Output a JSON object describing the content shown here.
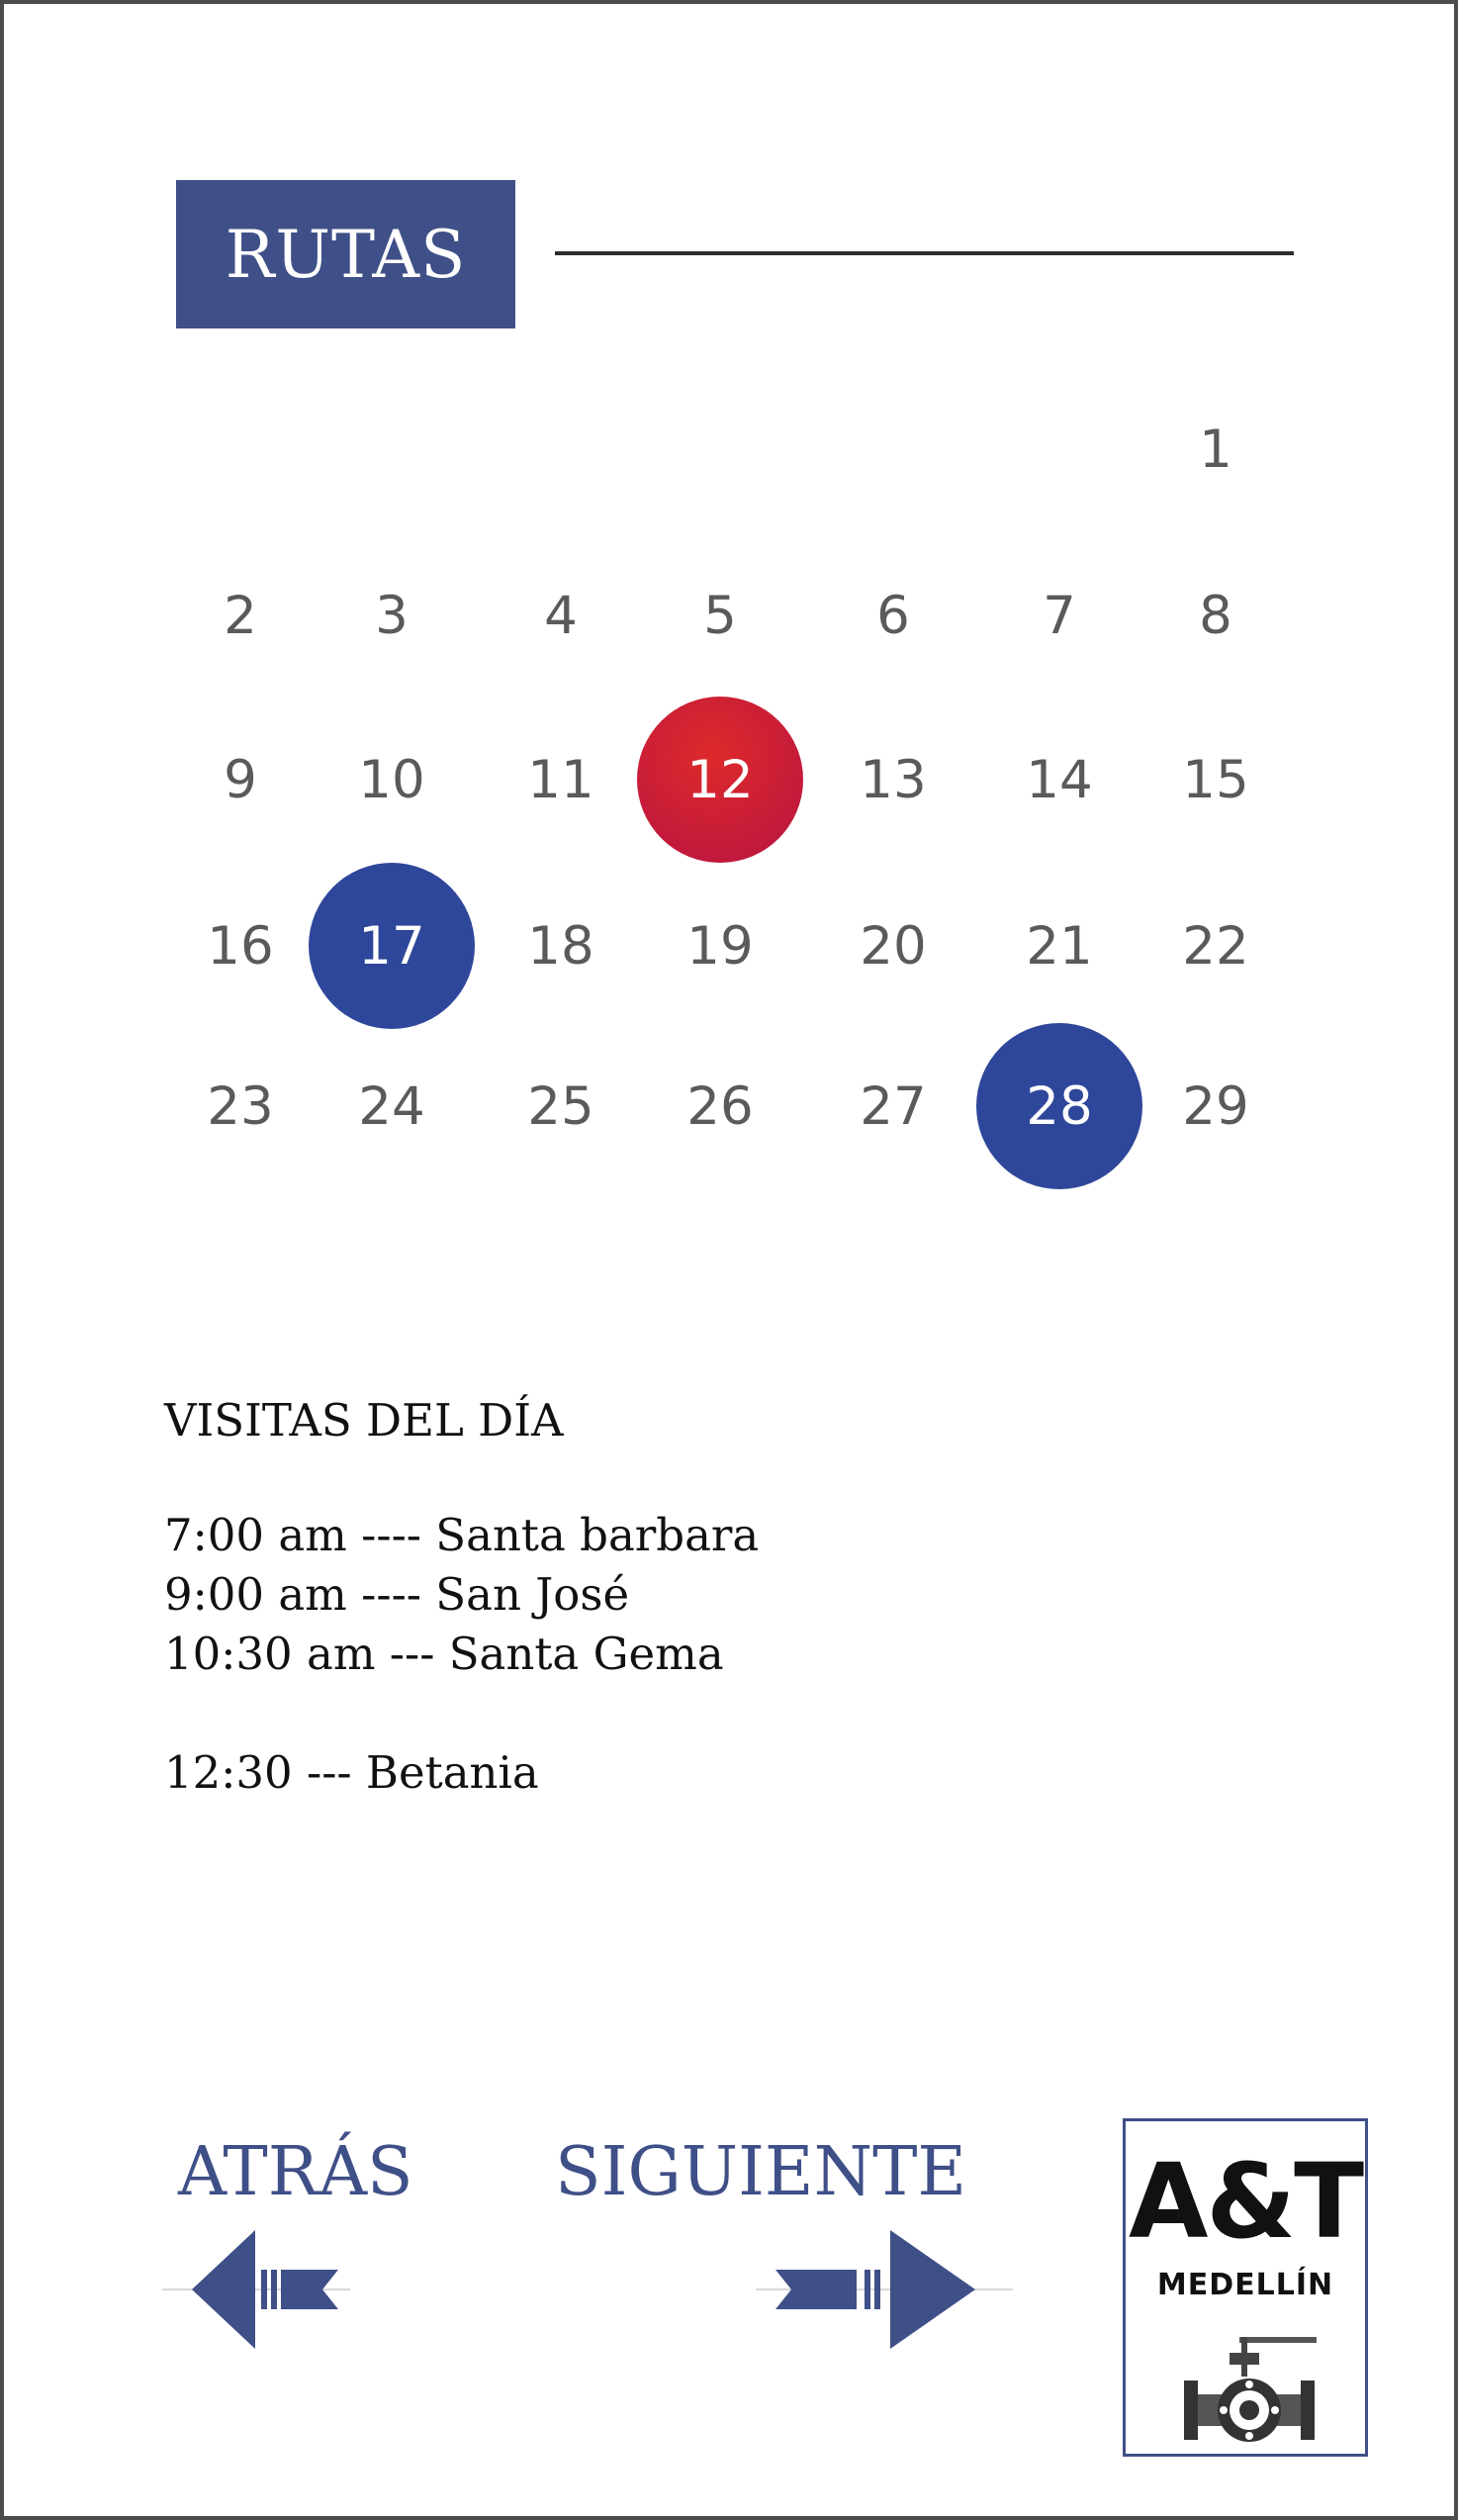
{
  "header": {
    "title": "RUTAS"
  },
  "calendar": {
    "days": [
      {
        "label": "1",
        "col": 7,
        "row": 1,
        "highlight": ""
      },
      {
        "label": "2",
        "col": 1,
        "row": 2,
        "highlight": ""
      },
      {
        "label": "3",
        "col": 2,
        "row": 2,
        "highlight": ""
      },
      {
        "label": "4",
        "col": 3,
        "row": 2,
        "highlight": ""
      },
      {
        "label": "5",
        "col": 4,
        "row": 2,
        "highlight": ""
      },
      {
        "label": "6",
        "col": 5,
        "row": 2,
        "highlight": ""
      },
      {
        "label": "7",
        "col": 6,
        "row": 2,
        "highlight": ""
      },
      {
        "label": "8",
        "col": 7,
        "row": 2,
        "highlight": ""
      },
      {
        "label": "9",
        "col": 1,
        "row": 3,
        "highlight": ""
      },
      {
        "label": "10",
        "col": 2,
        "row": 3,
        "highlight": ""
      },
      {
        "label": "11",
        "col": 3,
        "row": 3,
        "highlight": ""
      },
      {
        "label": "12",
        "col": 4,
        "row": 3,
        "highlight": "red"
      },
      {
        "label": "13",
        "col": 5,
        "row": 3,
        "highlight": ""
      },
      {
        "label": "14",
        "col": 6,
        "row": 3,
        "highlight": ""
      },
      {
        "label": "15",
        "col": 7,
        "row": 3,
        "highlight": ""
      },
      {
        "label": "16",
        "col": 1,
        "row": 4,
        "highlight": ""
      },
      {
        "label": "17",
        "col": 2,
        "row": 4,
        "highlight": "blue"
      },
      {
        "label": "18",
        "col": 3,
        "row": 4,
        "highlight": ""
      },
      {
        "label": "19",
        "col": 4,
        "row": 4,
        "highlight": ""
      },
      {
        "label": "20",
        "col": 5,
        "row": 4,
        "highlight": ""
      },
      {
        "label": "21",
        "col": 6,
        "row": 4,
        "highlight": ""
      },
      {
        "label": "22",
        "col": 7,
        "row": 4,
        "highlight": ""
      },
      {
        "label": "23",
        "col": 1,
        "row": 5,
        "highlight": ""
      },
      {
        "label": "24",
        "col": 2,
        "row": 5,
        "highlight": ""
      },
      {
        "label": "25",
        "col": 3,
        "row": 5,
        "highlight": ""
      },
      {
        "label": "26",
        "col": 4,
        "row": 5,
        "highlight": ""
      },
      {
        "label": "27",
        "col": 5,
        "row": 5,
        "highlight": ""
      },
      {
        "label": "28",
        "col": 6,
        "row": 5,
        "highlight": "blue"
      },
      {
        "label": "29",
        "col": 7,
        "row": 5,
        "highlight": ""
      }
    ],
    "colors": {
      "red": "#c8203a",
      "blue": "#2f479a",
      "text": "#5a5a5a"
    }
  },
  "visits": {
    "heading": "VISITAS DEL DÍA",
    "items": [
      "7:00 am ---- Santa barbara",
      "9:00 am ---- San José",
      "10:30 am --- Santa Gema",
      "12:30 --- Betania"
    ]
  },
  "nav": {
    "back_label": "ATRÁS",
    "next_label": "SIGUIENTE",
    "back_icon": "arrow-left-icon",
    "next_icon": "arrow-right-icon",
    "color": "#3f4f87"
  },
  "logo": {
    "main": "A&T",
    "sub": "MEDELLÍN",
    "icon": "valve-icon"
  }
}
